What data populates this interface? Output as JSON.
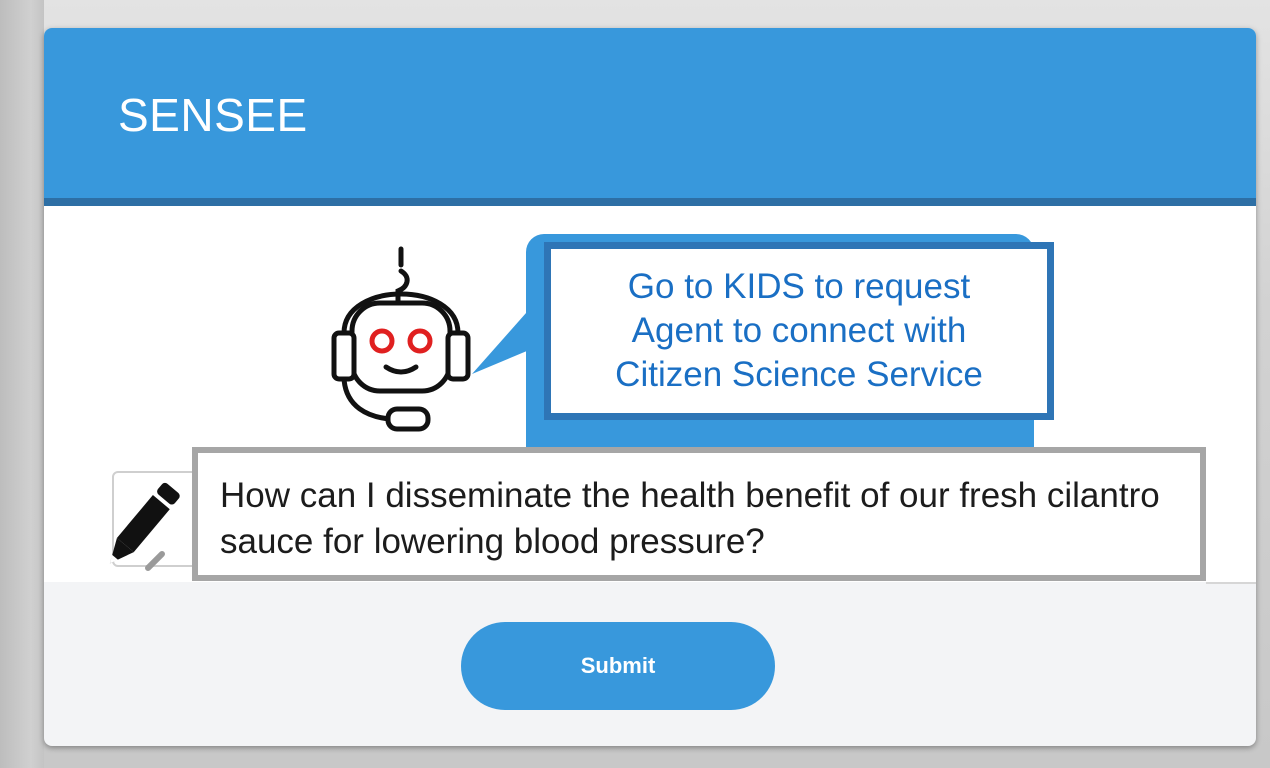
{
  "app": {
    "title": "SENSEE"
  },
  "bot": {
    "icon": "robot-headset-icon",
    "message": "Go to KIDS to request\nAgent to connect with\nCitizen Science Service"
  },
  "input": {
    "icon": "pencil-icon",
    "value": "How can I disseminate the health benefit of our fresh cilantro sauce for lowering blood pressure?"
  },
  "actions": {
    "submit_label": "Submit"
  },
  "colors": {
    "header": "#3898dc",
    "header_border": "#2d6fa5",
    "bubble_border": "#2e75b6",
    "bubble_text": "#1a6fc4",
    "robot_eyes": "#e02020"
  }
}
